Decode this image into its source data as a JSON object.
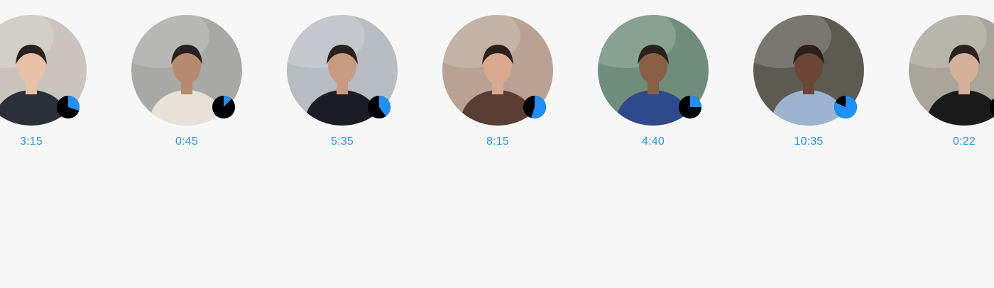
{
  "colors": {
    "background": "#f7f7f7",
    "time_label": "#2a93f2",
    "pie_fill": "#1e90ff",
    "pie_track": "#000000"
  },
  "contacts": [
    {
      "time": "3:15",
      "progress": 0.3,
      "photo": "woman-with-dog",
      "bg": "#c9c4bd",
      "accent": "#2b2f3a",
      "skin": "#e7c2a8"
    },
    {
      "time": "0:45",
      "progress": 0.12,
      "photo": "man-cap-rocks",
      "bg": "#a8a9a6",
      "accent": "#e6e2d8",
      "skin": "#b58a6e"
    },
    {
      "time": "5:35",
      "progress": 0.4,
      "photo": "woman-long-hair",
      "bg": "#b7bcc2",
      "accent": "#1b1d22",
      "skin": "#c99a82"
    },
    {
      "time": "8:15",
      "progress": 0.55,
      "photo": "woman-street",
      "bg": "#b9a293",
      "accent": "#5a3e35",
      "skin": "#d9a98f"
    },
    {
      "time": "4:40",
      "progress": 0.25,
      "photo": "man-denim-plants",
      "bg": "#6f8d7b",
      "accent": "#2e4a8a",
      "skin": "#8a5f47"
    },
    {
      "time": "10:35",
      "progress": 0.82,
      "photo": "man-smoking",
      "bg": "#5d5a52",
      "accent": "#9cb4cf",
      "skin": "#6b4634"
    },
    {
      "time": "0:22",
      "progress": 0.2,
      "photo": "woman-city",
      "bg": "#a9a59a",
      "accent": "#1a1a1a",
      "skin": "#d4b09a"
    }
  ]
}
